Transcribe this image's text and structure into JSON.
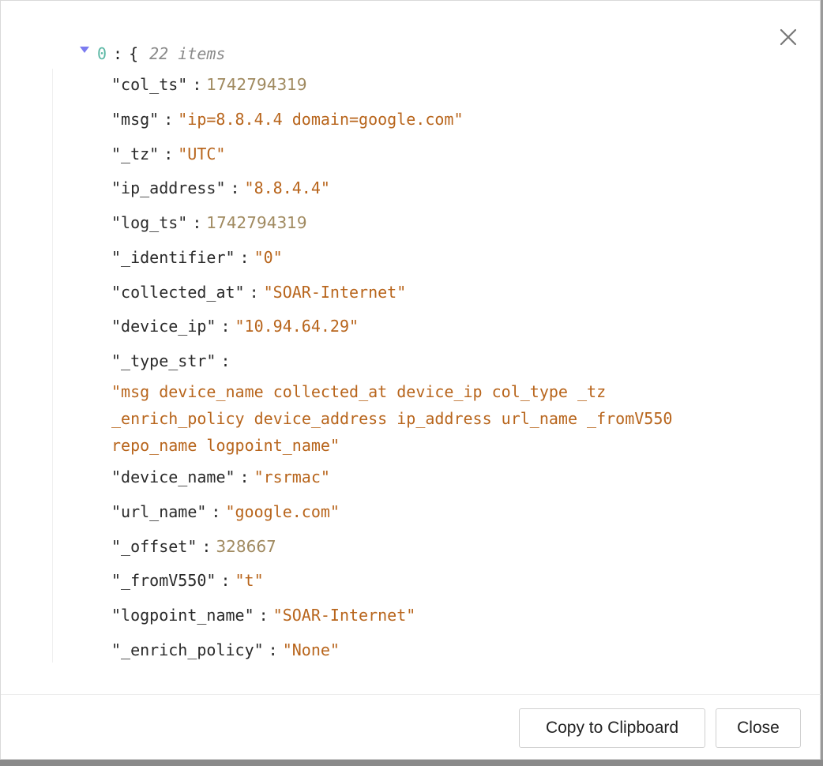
{
  "root": {
    "index": "0",
    "colon": ":",
    "brace": "{",
    "count": "22 items"
  },
  "rows": [
    {
      "key": "\"col_ts\"",
      "value": "1742794319",
      "type": "number"
    },
    {
      "key": "\"msg\"",
      "value": "\"ip=8.8.4.4 domain=google.com\"",
      "type": "string"
    },
    {
      "key": "\"_tz\"",
      "value": "\"UTC\"",
      "type": "string"
    },
    {
      "key": "\"ip_address\"",
      "value": "\"8.8.4.4\"",
      "type": "string"
    },
    {
      "key": "\"log_ts\"",
      "value": "1742794319",
      "type": "number"
    },
    {
      "key": "\"_identifier\"",
      "value": "\"0\"",
      "type": "string"
    },
    {
      "key": "\"collected_at\"",
      "value": "\"SOAR-Internet\"",
      "type": "string"
    },
    {
      "key": "\"device_ip\"",
      "value": "\"10.94.64.29\"",
      "type": "string"
    },
    {
      "key": "\"_type_str\"",
      "value": "\"msg device_name collected_at device_ip col_type _tz _enrich_policy device_address ip_address url_name _fromV550 repo_name logpoint_name\"",
      "type": "string"
    },
    {
      "key": "\"device_name\"",
      "value": "\"rsrmac\"",
      "type": "string"
    },
    {
      "key": "\"url_name\"",
      "value": "\"google.com\"",
      "type": "string"
    },
    {
      "key": "\"_offset\"",
      "value": "328667",
      "type": "number"
    },
    {
      "key": "\"_fromV550\"",
      "value": "\"t\"",
      "type": "string"
    },
    {
      "key": "\"logpoint_name\"",
      "value": "\"SOAR-Internet\"",
      "type": "string"
    },
    {
      "key": "\"_enrich_policy\"",
      "value": "\"None\"",
      "type": "string"
    }
  ],
  "colon": ":",
  "footer": {
    "copy_label": "Copy to Clipboard",
    "close_label": "Close"
  },
  "icons": {
    "close": "close-icon",
    "caret": "caret-down-icon"
  },
  "colors": {
    "string": "#b8651c",
    "number": "#a08a60",
    "index": "#5cb8a5",
    "caret": "#7b7bf0"
  }
}
